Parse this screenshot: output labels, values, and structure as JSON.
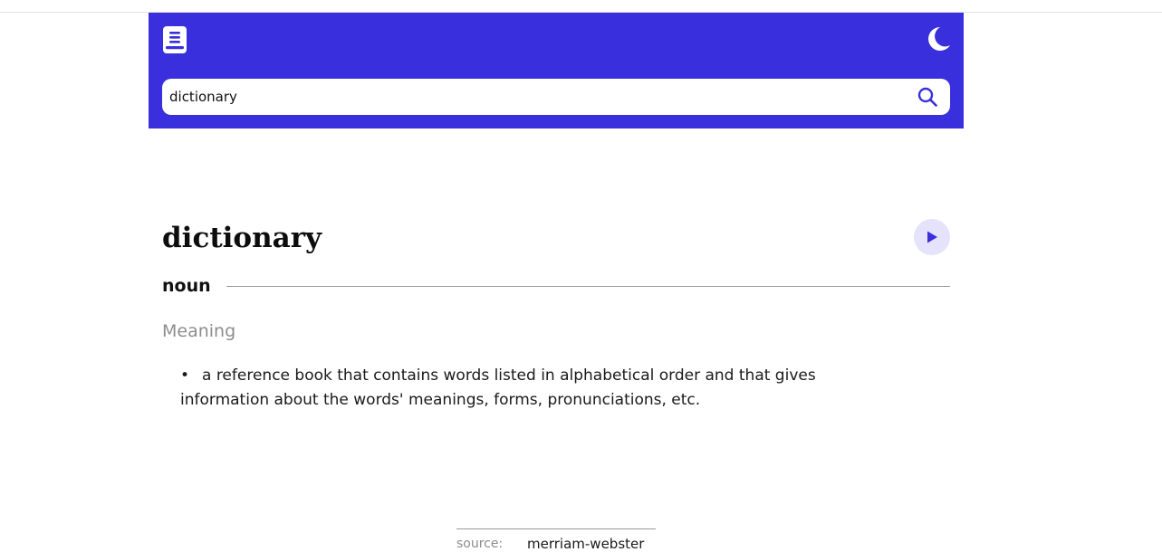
{
  "header": {
    "logo_icon": "book-icon",
    "theme_icon": "moon-icon",
    "accent_color": "#3a2fdc"
  },
  "search": {
    "value": "dictionary",
    "icon": "search-icon"
  },
  "entry": {
    "word": "dictionary",
    "play_icon": "play-icon",
    "part_of_speech": "noun",
    "meaning_heading": "Meaning",
    "definitions": [
      "a reference book that contains words listed in alphabetical order and that gives information about the words' meanings, forms, pronunciations, etc."
    ]
  },
  "footer": {
    "source_label": "source:",
    "source_name": "merriam-webster"
  }
}
